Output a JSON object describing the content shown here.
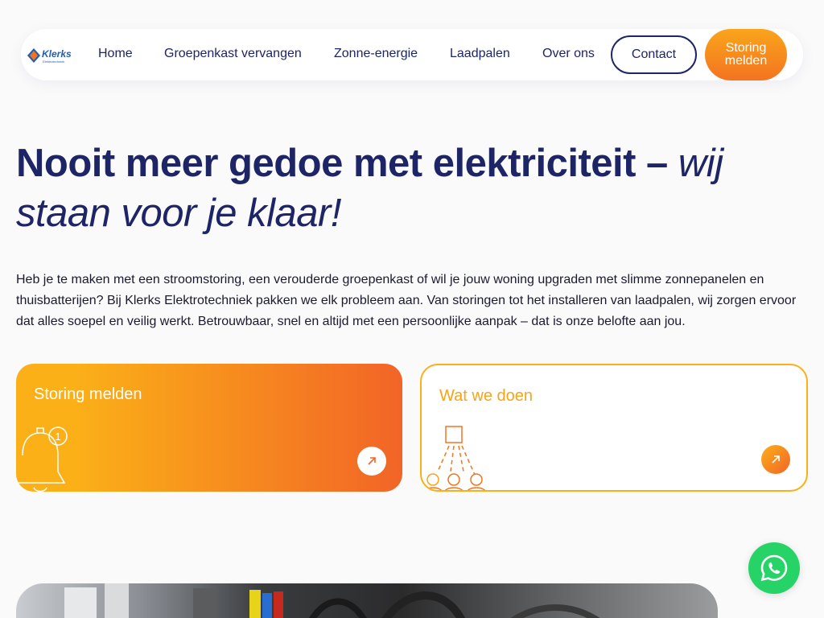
{
  "brand": {
    "name": "Klerks",
    "subtitle": "Elektrotechniek"
  },
  "nav": {
    "links": [
      "Home",
      "Groepenkast vervangen",
      "Zonne-energie",
      "Laadpalen",
      "Over ons"
    ],
    "contact_label": "Contact",
    "storing_label": "Storing melden"
  },
  "hero": {
    "title_bold": "Nooit meer gedoe met elektriciteit – ",
    "title_italic": "wij staan voor je klaar!"
  },
  "intro": "Heb je te maken met een stroomstoring, een verouderde groepenkast of wil je jouw woning upgraden met slimme zonnepanelen en thuisbatterijen? Bij Klerks Elektrotechniek pakken we elk probleem aan. Van storingen tot het installeren van laadpalen, wij zorgen ervoor dat alles soepel en veilig werkt. Betrouwbaar, snel en altijd met een persoonlijke aanpak – dat is onze belofte aan jou.",
  "cards": [
    {
      "title": "Storing melden",
      "icon": "bell-notification-icon",
      "badge": "1"
    },
    {
      "title": "Wat we doen",
      "icon": "team-icon"
    }
  ],
  "colors": {
    "navy": "#1e2566",
    "orange": "#f47321",
    "yellow": "#fbb018",
    "whatsapp": "#25d366"
  },
  "floating": {
    "icon": "whatsapp-icon"
  }
}
